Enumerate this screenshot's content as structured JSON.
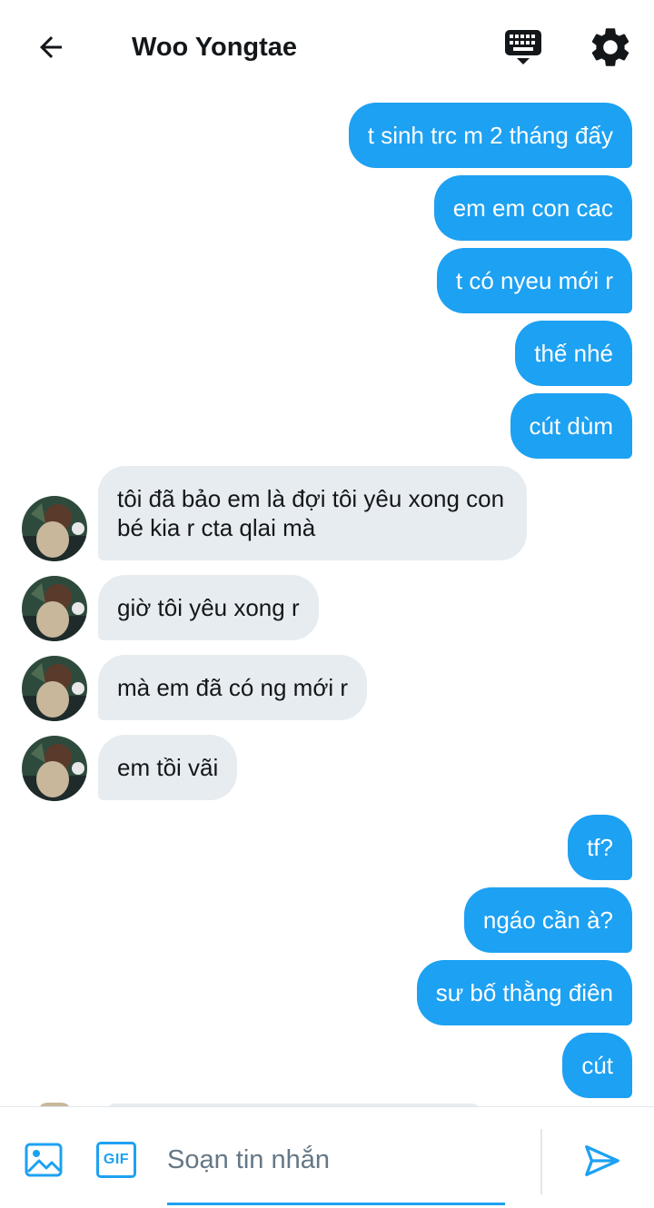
{
  "header": {
    "title": "Woo Yongtae",
    "back_icon": "arrow-left-icon",
    "keyboard_icon": "keyboard-icon",
    "settings_icon": "gear-icon"
  },
  "messages": [
    {
      "from": "me",
      "text": "t sinh trc m 2 tháng đấy"
    },
    {
      "from": "me",
      "text": "em em con cac"
    },
    {
      "from": "me",
      "text": "t có nyeu mới r"
    },
    {
      "from": "me",
      "text": "thế nhé"
    },
    {
      "from": "me",
      "text": "cút dùm"
    },
    {
      "from": "them",
      "text": "tôi đã bảo em là đợi tôi yêu xong con bé kia r cta qlai mà"
    },
    {
      "from": "them",
      "text": "giờ tôi yêu xong r"
    },
    {
      "from": "them",
      "text": "mà em đã có ng mới r"
    },
    {
      "from": "them",
      "text": "em tồi vãi"
    },
    {
      "from": "me",
      "text": "tf?"
    },
    {
      "from": "me",
      "text": "ngáo cần à?"
    },
    {
      "from": "me",
      "text": "sư bố thằng điên"
    },
    {
      "from": "me",
      "text": "cút"
    }
  ],
  "composer": {
    "placeholder": "Soạn tin nhắn",
    "gif_label": "GIF",
    "image_icon": "image-icon",
    "send_icon": "send-icon"
  },
  "colors": {
    "accent": "#1da1f2",
    "received_bubble": "#e6ecf0",
    "text": "#14171a",
    "placeholder": "#657786"
  }
}
